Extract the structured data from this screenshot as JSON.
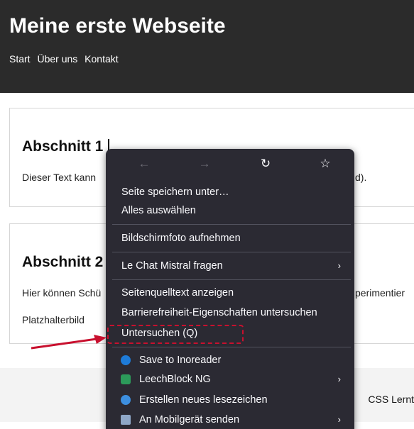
{
  "site": {
    "title": "Meine erste Webseite",
    "nav": [
      "Start",
      "Über uns",
      "Kontakt"
    ]
  },
  "sections": [
    {
      "heading": "Abschnitt 1",
      "text": "Dieser Text kann"
    },
    {
      "heading": "Abschnitt 2",
      "text": "Hier können Schü",
      "placeholder_image_label": "Platzhalterbild"
    }
  ],
  "partial_text": {
    "section1_right": "d).",
    "section2_right": "perimentier"
  },
  "footer": {
    "text": "CSS Lernt"
  },
  "context_menu": {
    "nav_icons": [
      "back-icon",
      "forward-icon",
      "reload-icon",
      "bookmark-star-icon"
    ],
    "nav_glyphs": [
      "←",
      "→",
      "↻",
      "☆"
    ],
    "items": [
      {
        "label": "Seite speichern unter…"
      },
      {
        "label": "Alles auswählen"
      },
      {
        "label": "Bildschirmfoto aufnehmen"
      },
      {
        "label": "Le Chat Mistral fragen",
        "submenu": true
      },
      {
        "label": "Seitenquelltext anzeigen"
      },
      {
        "label": "Barrierefreiheit-Eigenschaften untersuchen"
      },
      {
        "label": "Untersuchen (Q)"
      },
      {
        "label": "Save to Inoreader",
        "icon": "inoreader-icon",
        "icon_color": "#1e7bd8"
      },
      {
        "label": "LeechBlock NG",
        "icon": "leechblock-icon",
        "icon_color": "#2c9a5a",
        "submenu": true
      },
      {
        "label": "Erstellen neues lesezeichen",
        "icon": "bookmark-cloud-icon",
        "icon_color": "#3d8fe0"
      },
      {
        "label": "An Mobilgerät senden",
        "icon": "send-to-device-icon",
        "icon_color": "#8fa8c8",
        "submenu": true
      }
    ],
    "submenu_glyph": "›"
  },
  "annotation": {
    "highlight_color": "#c8102e"
  }
}
